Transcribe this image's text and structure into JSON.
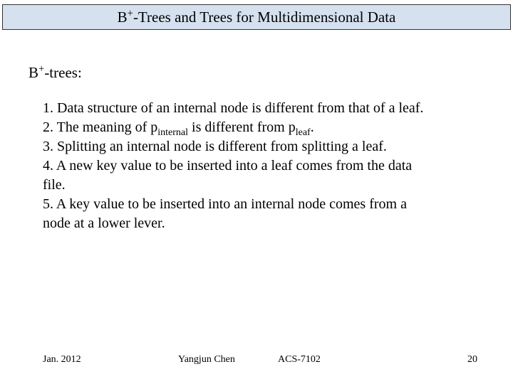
{
  "title": {
    "prefix": "B",
    "sup": "+",
    "rest": "-Trees and Trees for Multidimensional Data"
  },
  "subheading": {
    "prefix": "B",
    "sup": "+",
    "rest": "-trees:"
  },
  "items": {
    "i1": "1. Data structure of an internal node is different from that of a leaf.",
    "i2a": "2. The meaning of p",
    "i2sub1": "internal",
    "i2b": " is different from p",
    "i2sub2": "leaf",
    "i2c": ".",
    "i3": "3. Splitting an internal node is different from splitting a leaf.",
    "i4": "4. A new key value to be inserted into a leaf comes from the data",
    "i4b": "file.",
    "i5": "5. A key value to be inserted into an internal node comes from a",
    "i5b": "node at a lower lever."
  },
  "footer": {
    "date": "Jan. 2012",
    "author": "Yangjun Chen",
    "course": "ACS-7102",
    "page": "20"
  }
}
